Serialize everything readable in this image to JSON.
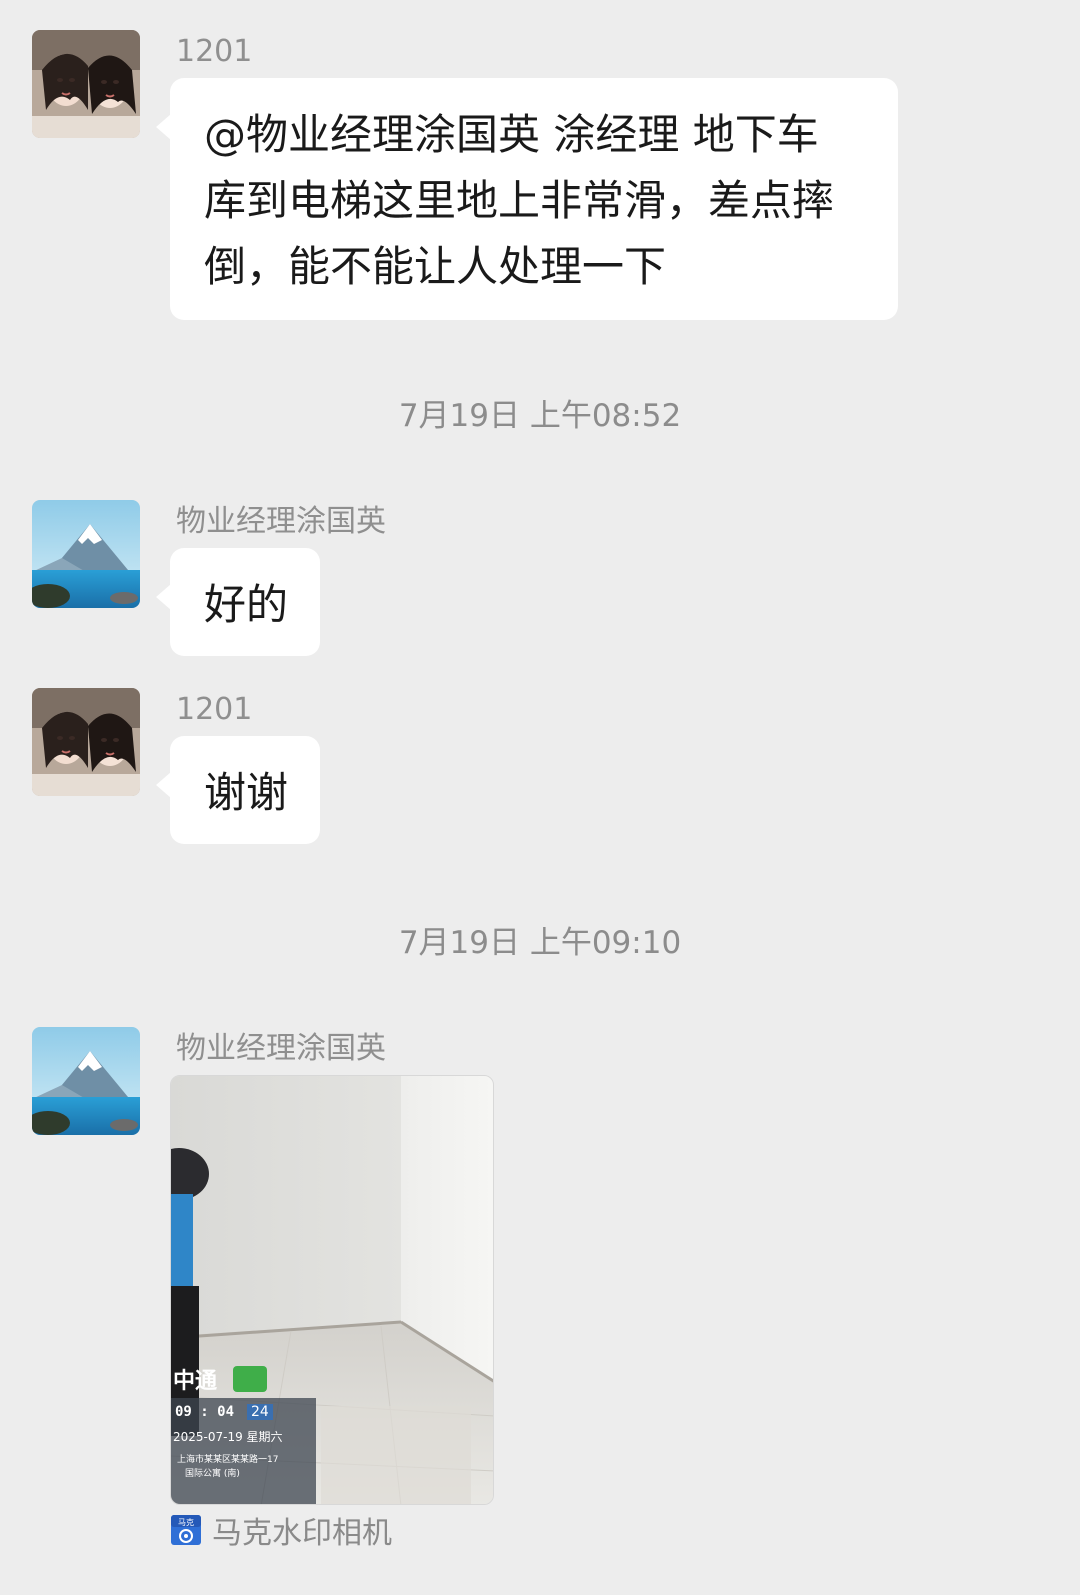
{
  "messages": [
    {
      "sender": "1201",
      "text_lines": [
        "@物业经理涂国英 涂经理 地下车",
        "库到电梯这里地上非常滑，差点摔",
        "倒，能不能让人处理一下"
      ]
    },
    {
      "timestamp": "7月19日 上午08:52"
    },
    {
      "sender": "物业经理涂国英",
      "text": "好的"
    },
    {
      "sender": "1201",
      "text": "谢谢"
    },
    {
      "timestamp": "7月19日 上午09:10"
    },
    {
      "sender": "物业经理涂国英",
      "image": {
        "watermark_time": "09 : 04",
        "watermark_day": "24",
        "watermark_date": "2025-07-19 星期六",
        "watermark_line1": "上海市某某区某某路一17",
        "watermark_line2": "国际公寓 (南)"
      },
      "source_label": "马克水印相机"
    }
  ],
  "colors": {
    "background": "#ededed",
    "bubble": "#ffffff",
    "secondary_text": "#8c8c8c"
  },
  "icons": {
    "avatar_1201": "two-girls-avatar",
    "avatar_manager": "mountain-lake-avatar",
    "source_app": "camera-app-icon"
  }
}
